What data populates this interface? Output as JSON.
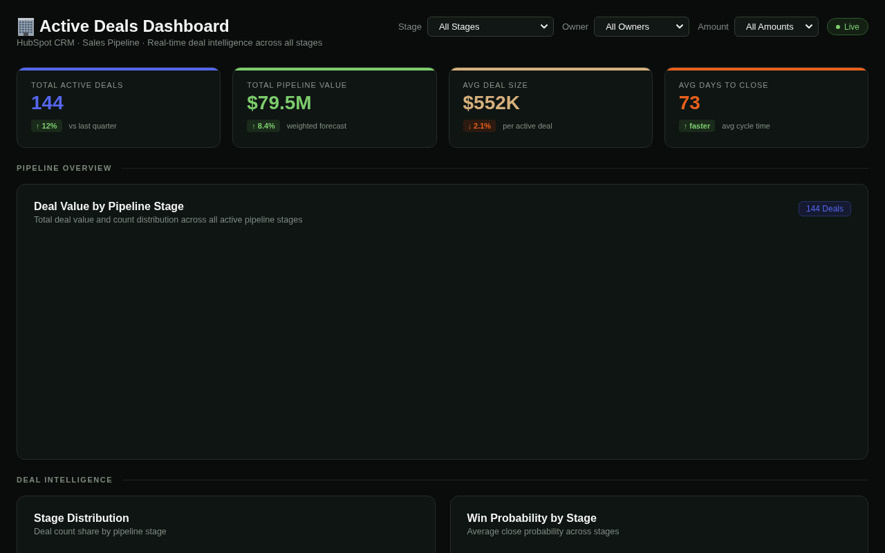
{
  "header": {
    "title": "Active Deals Dashboard",
    "subtitle": "HubSpot CRM · Sales Pipeline · Real-time deal intelligence across all stages"
  },
  "filters": [
    {
      "label": "Stage",
      "value": "All Stages"
    },
    {
      "label": "Owner",
      "value": "All Owners"
    },
    {
      "label": "Amount",
      "value": "All Amounts"
    }
  ],
  "live_badge": {
    "label": "Live"
  },
  "kpis": [
    {
      "label": "TOTAL ACTIVE DEALS",
      "value": "144",
      "color": "#5566ee",
      "change": "↑ 12%",
      "kind": "up",
      "note": "vs last quarter"
    },
    {
      "label": "TOTAL PIPELINE VALUE",
      "value": "$79.5M",
      "color": "#7ccc6c",
      "change": "↑ 8.4%",
      "kind": "up",
      "note": "weighted forecast"
    },
    {
      "label": "AVG DEAL SIZE",
      "value": "$552K",
      "color": "#d6b07c",
      "change": "↓ 2.1%",
      "kind": "down",
      "note": "per active deal"
    },
    {
      "label": "AVG DAYS TO CLOSE",
      "value": "73",
      "color": "#e8601c",
      "change": "↑ faster",
      "kind": "up",
      "note": "avg cycle time"
    }
  ],
  "sections": [
    {
      "title": "PIPELINE OVERVIEW",
      "kind": "full",
      "cards": [
        {
          "title": "Deal Value by Pipeline Stage",
          "subtitle": "Total deal value and count distribution across all active pipeline stages",
          "badge": "144 Deals"
        }
      ]
    },
    {
      "title": "DEAL INTELLIGENCE",
      "kind": "split",
      "cards": [
        {
          "title": "Stage Distribution",
          "subtitle": "Deal count share by pipeline stage"
        },
        {
          "title": "Win Probability by Stage",
          "subtitle": "Average close probability across stages"
        }
      ]
    }
  ]
}
